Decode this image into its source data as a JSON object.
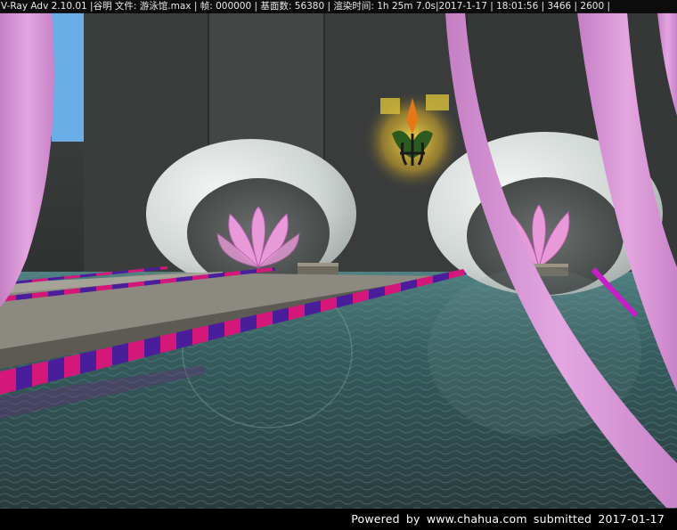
{
  "overlay": {
    "render_info": "V-Ray Adv 2.10.01 |谷明 文件: 游泳馆.max | 帧: 000000 | 基面数: 56380 | 渲染时间:  1h 25m  7.0s|2017-1-17 | 18:01:56 | 3466 | 2600 |",
    "credit": "Powered  by  www.chahua.com  submitted  2017-01-17"
  },
  "scene": {
    "subject": "indoor swimming pool 3D render",
    "colors": {
      "wall": "#3a3c3b",
      "water": "#3f6b6c",
      "sky": "#6aaee8",
      "pink_arch": "#d98fd6",
      "lane_pink": "#d3187a",
      "lane_purple": "#4a1d9a",
      "dome": "#d8dedb",
      "lotus": "#e89ad8"
    }
  }
}
